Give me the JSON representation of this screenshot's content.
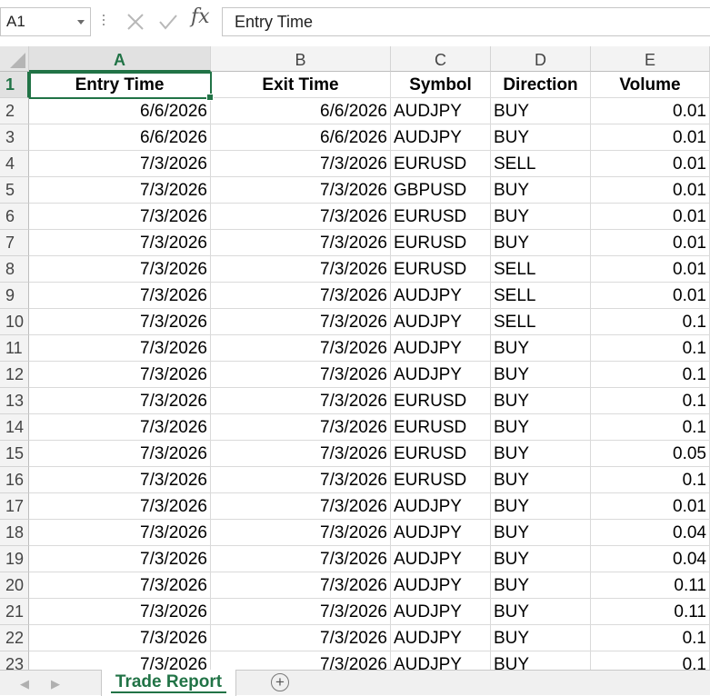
{
  "formula_bar": {
    "name_box": "A1",
    "formula": "Entry Time",
    "fx_label": "fx"
  },
  "columns": [
    {
      "letter": "A",
      "header": "Entry Time"
    },
    {
      "letter": "B",
      "header": "Exit Time"
    },
    {
      "letter": "C",
      "header": "Symbol"
    },
    {
      "letter": "D",
      "header": "Direction"
    },
    {
      "letter": "E",
      "header": "Volume"
    }
  ],
  "header_row_number": "1",
  "rows": [
    {
      "num": "2",
      "entry": "6/6/2026",
      "exit": "6/6/2026",
      "symbol": "AUDJPY",
      "direction": "BUY",
      "volume": "0.01"
    },
    {
      "num": "3",
      "entry": "6/6/2026",
      "exit": "6/6/2026",
      "symbol": "AUDJPY",
      "direction": "BUY",
      "volume": "0.01"
    },
    {
      "num": "4",
      "entry": "7/3/2026",
      "exit": "7/3/2026",
      "symbol": "EURUSD",
      "direction": "SELL",
      "volume": "0.01"
    },
    {
      "num": "5",
      "entry": "7/3/2026",
      "exit": "7/3/2026",
      "symbol": "GBPUSD",
      "direction": "BUY",
      "volume": "0.01"
    },
    {
      "num": "6",
      "entry": "7/3/2026",
      "exit": "7/3/2026",
      "symbol": "EURUSD",
      "direction": "BUY",
      "volume": "0.01"
    },
    {
      "num": "7",
      "entry": "7/3/2026",
      "exit": "7/3/2026",
      "symbol": "EURUSD",
      "direction": "BUY",
      "volume": "0.01"
    },
    {
      "num": "8",
      "entry": "7/3/2026",
      "exit": "7/3/2026",
      "symbol": "EURUSD",
      "direction": "SELL",
      "volume": "0.01"
    },
    {
      "num": "9",
      "entry": "7/3/2026",
      "exit": "7/3/2026",
      "symbol": "AUDJPY",
      "direction": "SELL",
      "volume": "0.01"
    },
    {
      "num": "10",
      "entry": "7/3/2026",
      "exit": "7/3/2026",
      "symbol": "AUDJPY",
      "direction": "SELL",
      "volume": "0.1"
    },
    {
      "num": "11",
      "entry": "7/3/2026",
      "exit": "7/3/2026",
      "symbol": "AUDJPY",
      "direction": "BUY",
      "volume": "0.1"
    },
    {
      "num": "12",
      "entry": "7/3/2026",
      "exit": "7/3/2026",
      "symbol": "AUDJPY",
      "direction": "BUY",
      "volume": "0.1"
    },
    {
      "num": "13",
      "entry": "7/3/2026",
      "exit": "7/3/2026",
      "symbol": "EURUSD",
      "direction": "BUY",
      "volume": "0.1"
    },
    {
      "num": "14",
      "entry": "7/3/2026",
      "exit": "7/3/2026",
      "symbol": "EURUSD",
      "direction": "BUY",
      "volume": "0.1"
    },
    {
      "num": "15",
      "entry": "7/3/2026",
      "exit": "7/3/2026",
      "symbol": "EURUSD",
      "direction": "BUY",
      "volume": "0.05"
    },
    {
      "num": "16",
      "entry": "7/3/2026",
      "exit": "7/3/2026",
      "symbol": "EURUSD",
      "direction": "BUY",
      "volume": "0.1"
    },
    {
      "num": "17",
      "entry": "7/3/2026",
      "exit": "7/3/2026",
      "symbol": "AUDJPY",
      "direction": "BUY",
      "volume": "0.01"
    },
    {
      "num": "18",
      "entry": "7/3/2026",
      "exit": "7/3/2026",
      "symbol": "AUDJPY",
      "direction": "BUY",
      "volume": "0.04"
    },
    {
      "num": "19",
      "entry": "7/3/2026",
      "exit": "7/3/2026",
      "symbol": "AUDJPY",
      "direction": "BUY",
      "volume": "0.04"
    },
    {
      "num": "20",
      "entry": "7/3/2026",
      "exit": "7/3/2026",
      "symbol": "AUDJPY",
      "direction": "BUY",
      "volume": "0.11"
    },
    {
      "num": "21",
      "entry": "7/3/2026",
      "exit": "7/3/2026",
      "symbol": "AUDJPY",
      "direction": "BUY",
      "volume": "0.11"
    },
    {
      "num": "22",
      "entry": "7/3/2026",
      "exit": "7/3/2026",
      "symbol": "AUDJPY",
      "direction": "BUY",
      "volume": "0.1"
    },
    {
      "num": "23",
      "entry": "7/3/2026",
      "exit": "7/3/2026",
      "symbol": "AUDJPY",
      "direction": "BUY",
      "volume": "0.1"
    }
  ],
  "sheet_tabs": {
    "active": "Trade Report",
    "add_label": "+"
  },
  "colors": {
    "accent": "#217346",
    "gridline": "#dadada",
    "header_bg": "#f3f3f3"
  }
}
